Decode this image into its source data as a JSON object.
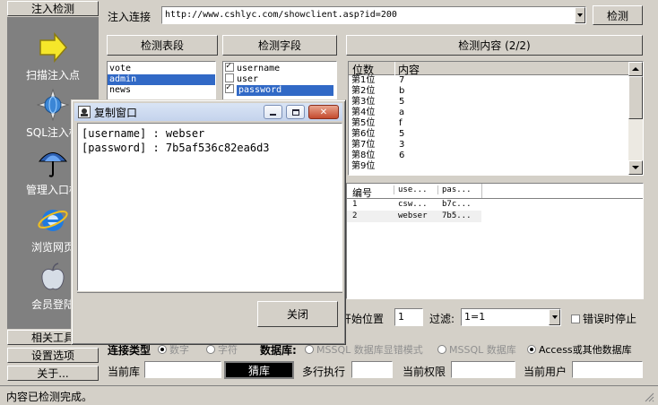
{
  "sidebar": {
    "top_tab": "注入检测",
    "items": [
      {
        "label": "扫描注入点",
        "icon": "arrow-right-icon"
      },
      {
        "label": "SQL注入检",
        "icon": "globe-scan-icon"
      },
      {
        "label": "管理入口检",
        "icon": "umbrella-icon"
      },
      {
        "label": "浏览网页",
        "icon": "ie-browser-icon"
      },
      {
        "label": "会员登陆",
        "icon": "apple-icon"
      }
    ],
    "bottom_tabs": [
      "相关工具",
      "设置选项",
      "关于..."
    ]
  },
  "url_bar": {
    "label": "注入连接",
    "value": "http://www.cshlyc.com/showclient.asp?id=200",
    "detect_button": "检测"
  },
  "tables_panel": {
    "button": "检测表段",
    "items": [
      "vote",
      "admin",
      "news"
    ],
    "selected": "admin"
  },
  "fields_panel": {
    "button": "检测字段",
    "items": [
      {
        "name": "username",
        "checked": true
      },
      {
        "name": "user",
        "checked": false
      },
      {
        "name": "password",
        "checked": true
      }
    ],
    "selected": "password"
  },
  "content_panel": {
    "button": "检测内容 (2/2)",
    "columns": [
      "位数",
      "内容"
    ],
    "rows": [
      [
        "第1位",
        "7"
      ],
      [
        "第2位",
        "b"
      ],
      [
        "第3位",
        "5"
      ],
      [
        "第4位",
        "a"
      ],
      [
        "第5位",
        "f"
      ],
      [
        "第6位",
        "5"
      ],
      [
        "第7位",
        "3"
      ],
      [
        "第8位",
        "6"
      ],
      [
        "第9位",
        ""
      ]
    ]
  },
  "result_grid": {
    "columns": [
      "编号",
      "use...",
      "pas..."
    ],
    "rows": [
      [
        "1",
        "csw...",
        "b7c..."
      ],
      [
        "2",
        "webser",
        "7b5..."
      ]
    ]
  },
  "options": {
    "start_pos_label": "开始位置",
    "start_pos_value": "1",
    "filter_label": "过滤:",
    "filter_value": "1=1",
    "stop_on_error_label": "错误时停止",
    "conn_type_label": "连接类型",
    "conn_types": [
      "数字",
      "字符"
    ],
    "db_label": "数据库:",
    "db_options": [
      "MSSQL 数据库显错模式",
      "MSSQL 数据库",
      "Access或其他数据库"
    ],
    "current_db_label": "当前库",
    "current_db_value": "",
    "guess_button": "猜库",
    "multi_exec_label": "多行执行",
    "current_perm_label": "当前权限",
    "current_user_label": "当前用户"
  },
  "dialog": {
    "title": "复制窗口",
    "lines": [
      "[username] : webser",
      "[password] : 7b5af536c82ea6d3"
    ],
    "close_button": "关闭"
  },
  "status": {
    "text": "内容已检测完成。"
  }
}
